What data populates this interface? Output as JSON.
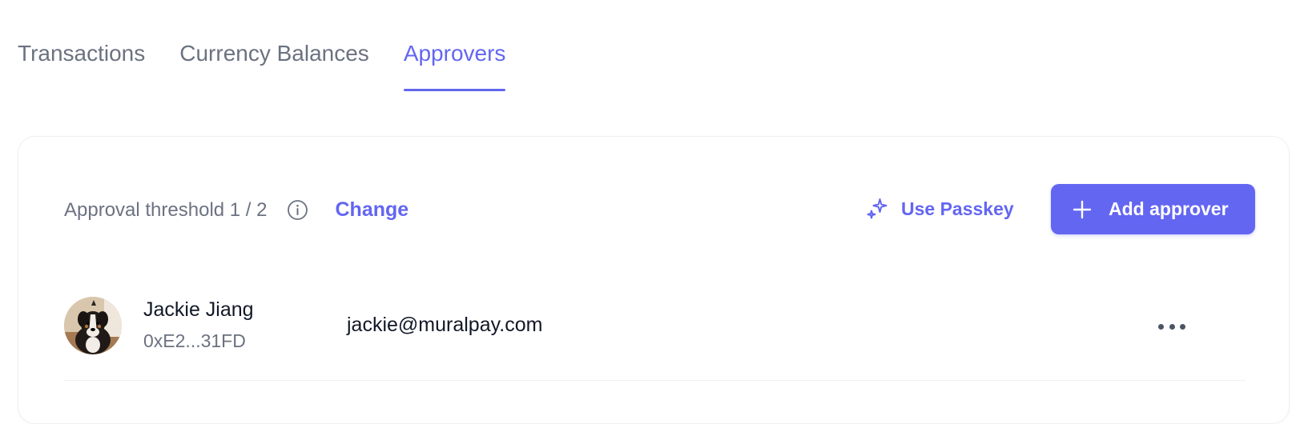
{
  "tabs": [
    {
      "label": "Transactions",
      "active": false
    },
    {
      "label": "Currency Balances",
      "active": false
    },
    {
      "label": "Approvers",
      "active": true
    }
  ],
  "toolbar": {
    "threshold_text": "Approval threshold 1 / 2",
    "info_icon": "info-circle-icon",
    "change_label": "Change",
    "passkey_label": "Use Passkey",
    "passkey_icon": "sparkles-icon",
    "add_approver_label": "Add approver",
    "add_icon": "plus-icon"
  },
  "approvers": [
    {
      "name": "Jackie Jiang",
      "address": "0xE2...31FD",
      "email": "jackie@muralpay.com",
      "avatar": "dog-photo-avatar",
      "menu_icon": "more-horizontal-icon"
    }
  ],
  "colors": {
    "accent": "#6366f1",
    "muted_text": "#6b7280",
    "primary_text": "#111827",
    "border": "#eef0f3"
  }
}
